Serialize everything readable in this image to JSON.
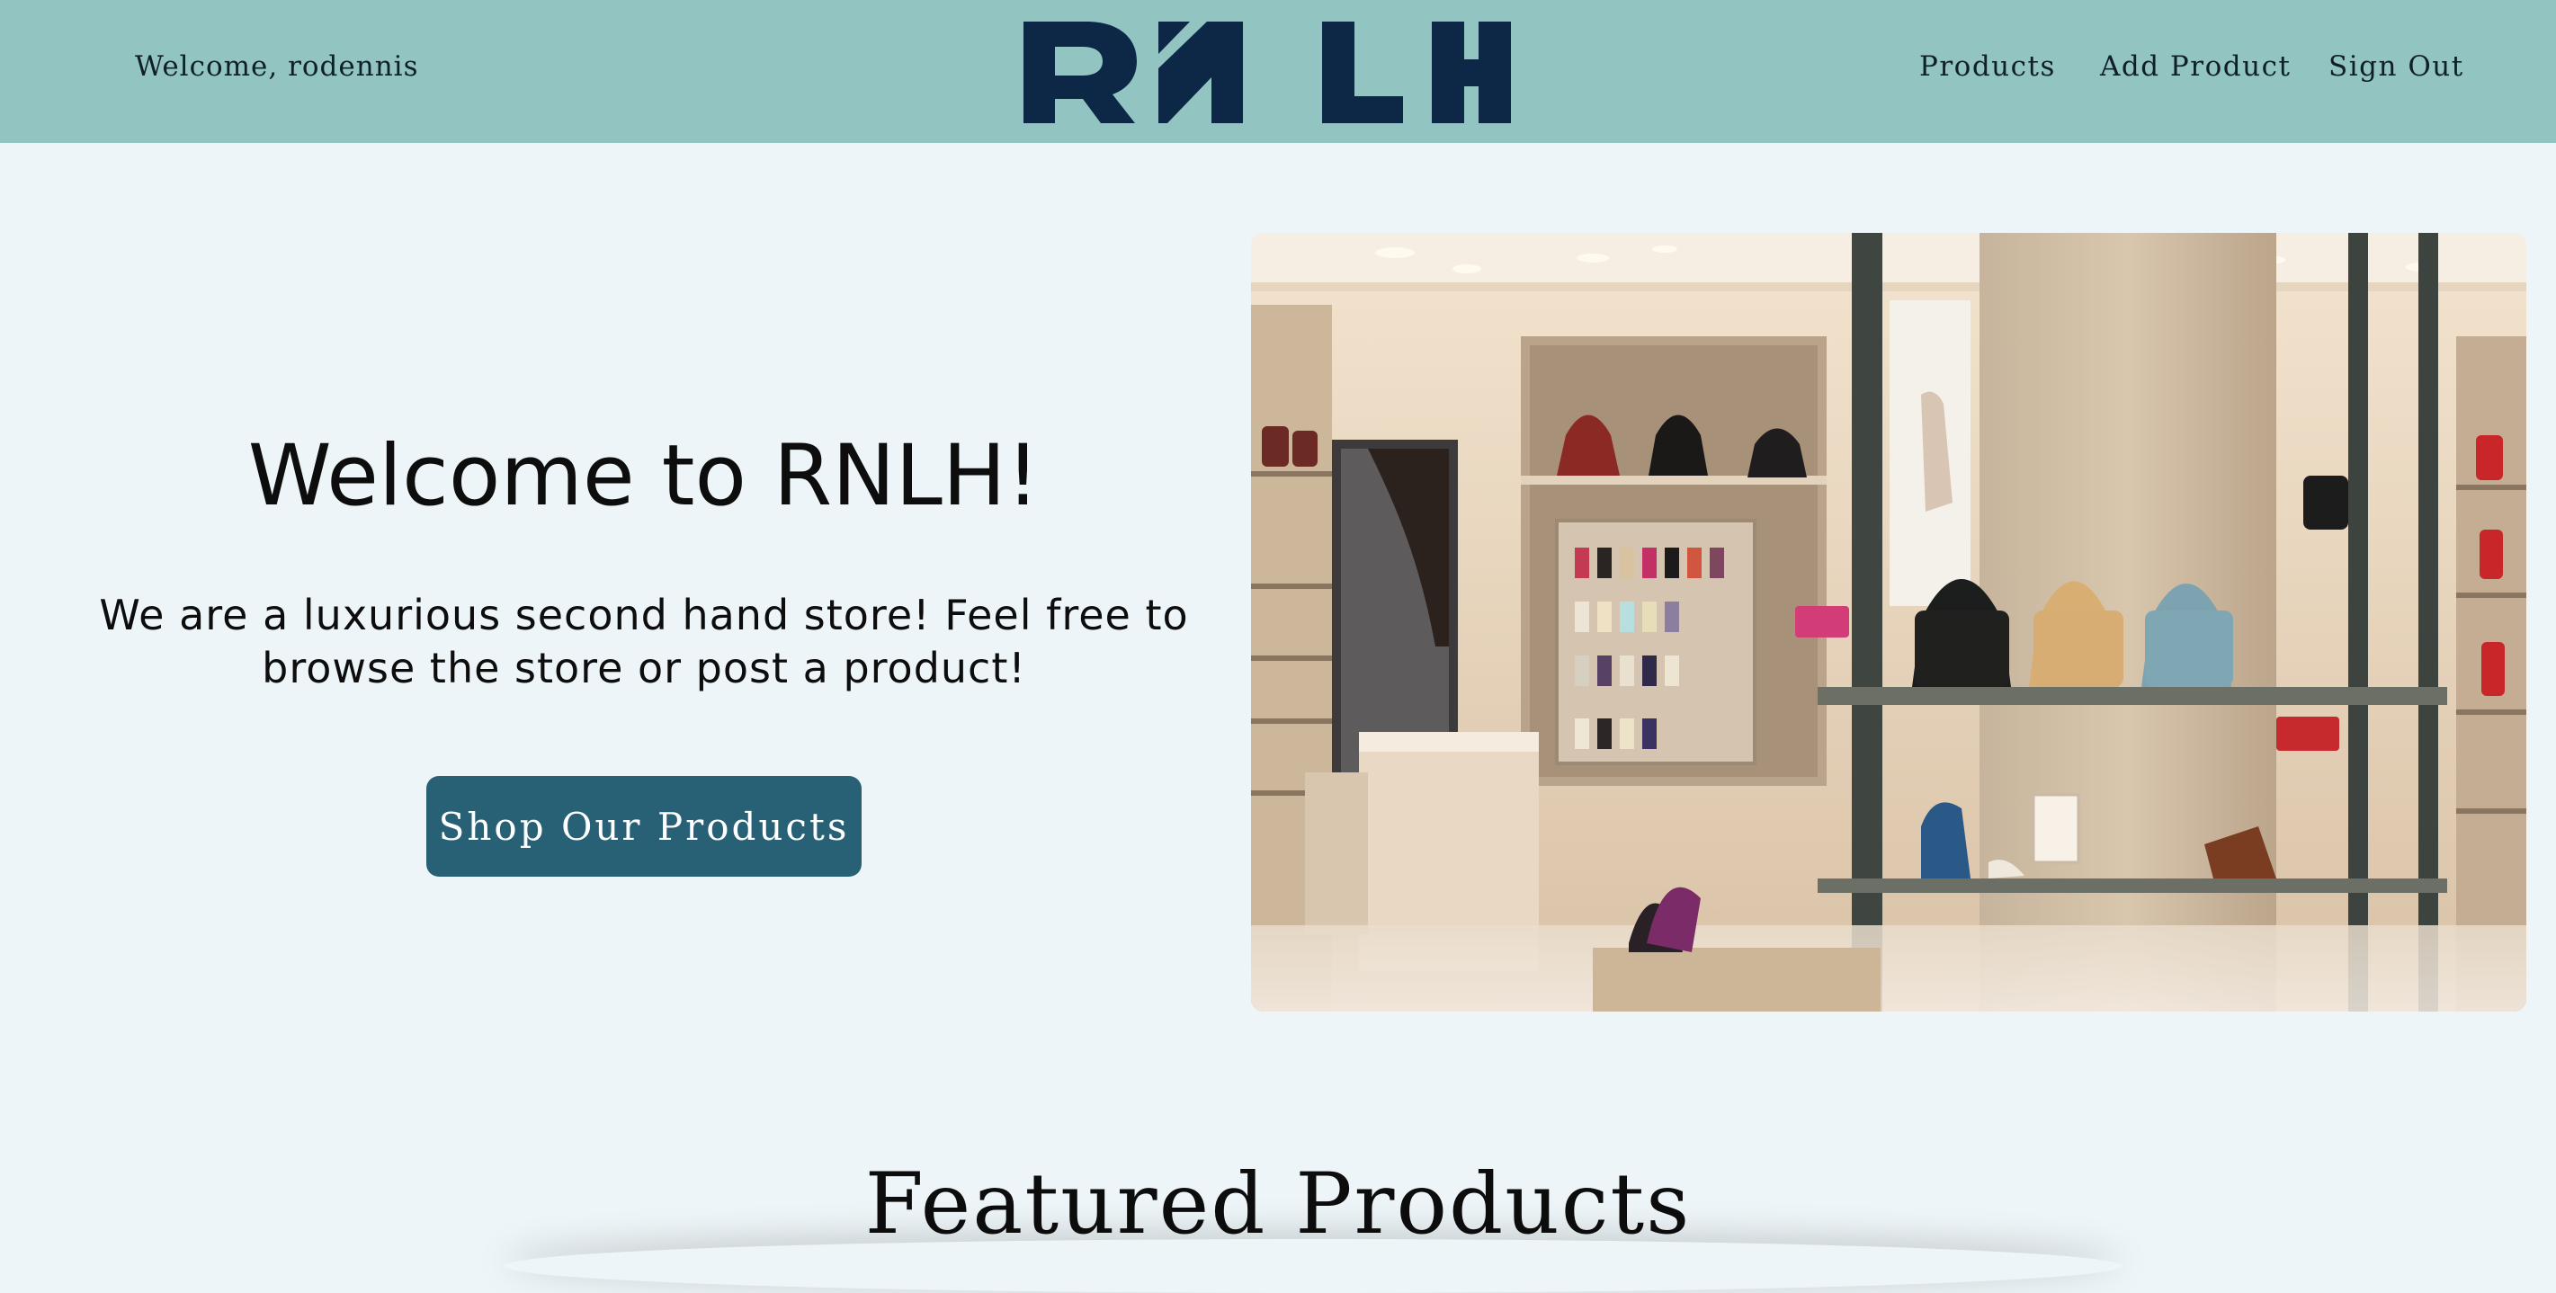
{
  "header": {
    "welcome_text": "Welcome, rodennis",
    "logo_text": "RNLH",
    "nav": {
      "products": "Products",
      "add_product": "Add Product",
      "sign_out": "Sign Out"
    }
  },
  "hero": {
    "title": "Welcome to RNLH!",
    "subtitle_line1": "We are a luxurious second hand store! Feel free to",
    "subtitle_line2": "browse the store or post a product!",
    "button_label": "Shop Our Products"
  },
  "featured": {
    "title": "Featured Products"
  },
  "colors": {
    "header_bg": "#92c4c1",
    "page_bg": "#edf5f8",
    "logo": "#0d2747",
    "button_bg": "#286175"
  }
}
